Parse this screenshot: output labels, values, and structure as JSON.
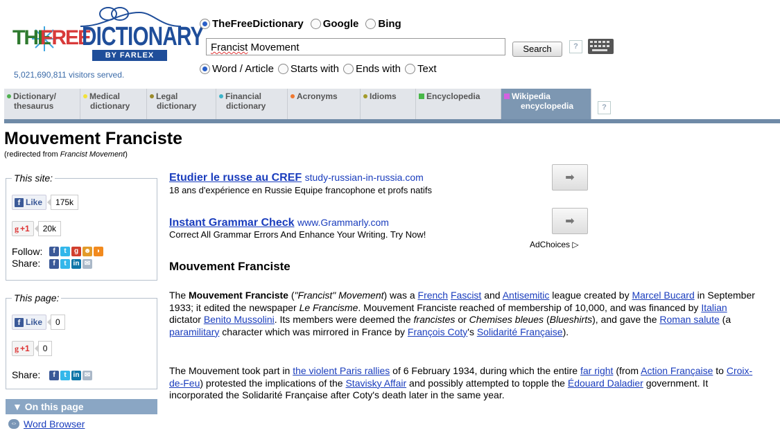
{
  "logo": {
    "the": "THE",
    "free": "FREE",
    "dictionary": "DICTIONARY",
    "by_farlex": "BY FARLEX",
    "visitors": "5,021,690,811 visitors served."
  },
  "search": {
    "engines": [
      "TheFreeDictionary",
      "Google",
      "Bing"
    ],
    "selected_engine": "TheFreeDictionary",
    "query_word1": "Francist",
    "query_word2": " Movement",
    "button": "Search",
    "help": "?",
    "modes": [
      "Word / Article",
      "Starts with",
      "Ends with",
      "Text"
    ],
    "selected_mode": "Word / Article"
  },
  "tabs": [
    {
      "line1": "Dictionary/",
      "line2": "thesaurus",
      "color": "#4fb04f",
      "shape": "dot"
    },
    {
      "line1": "Medical",
      "line2": "dictionary",
      "color": "#f2e23b",
      "shape": "dot"
    },
    {
      "line1": "Legal",
      "line2": "dictionary",
      "color": "#9a8a2a",
      "shape": "dot"
    },
    {
      "line1": "Financial",
      "line2": "dictionary",
      "color": "#3cb3c9",
      "shape": "dot"
    },
    {
      "line1": "Acronyms",
      "line2": "",
      "color": "#f07830",
      "shape": "dot"
    },
    {
      "line1": "Idioms",
      "line2": "",
      "color": "#a39a2a",
      "shape": "dot"
    },
    {
      "line1": "Encyclopedia",
      "line2": "",
      "color": "#48b848",
      "shape": "square"
    },
    {
      "line1": "Wikipedia",
      "line2": "encyclopedia",
      "color": "#d560e0",
      "shape": "square",
      "active": true
    }
  ],
  "tab_help": "?",
  "page": {
    "title": "Mouvement Franciste",
    "redirect_prefix": "(redirected from ",
    "redirect_term": "Francist Movement",
    "redirect_suffix": ")"
  },
  "this_site": {
    "legend": "This site:",
    "like_label": "Like",
    "like_count": "175k",
    "plus_label": "+1",
    "plus_count": "20k",
    "follow_label": "Follow:",
    "share_label": "Share:"
  },
  "this_page": {
    "legend": "This page:",
    "like_label": "Like",
    "like_count": "0",
    "plus_label": "+1",
    "plus_count": "0",
    "share_label": "Share:"
  },
  "on_this_page": {
    "header": "▼ On this page",
    "word_browser": "Word Browser"
  },
  "ads": [
    {
      "title": "Etudier le russe au CREF",
      "domain": "study-russian-in-russia.com",
      "desc": "18 ans d'expérience en Russie Equipe francophone et profs natifs"
    },
    {
      "title": "Instant Grammar Check",
      "domain": "www.Grammarly.com",
      "desc": "Correct All Grammar Errors And Enhance Your Writing. Try Now!"
    }
  ],
  "ad_arrow": "➡",
  "adchoices": "AdChoices ▷",
  "article": {
    "heading": "Mouvement Franciste",
    "p1": {
      "t1": "The ",
      "b1": "Mouvement Franciste",
      "t2": " (",
      "i1": "\"Francist\" Movement",
      "t3": ") was a ",
      "l1": "French",
      "t4": " ",
      "l2": "Fascist",
      "t5": " and ",
      "l3": "Antisemitic",
      "t6": " league created by ",
      "l4": "Marcel Bucard",
      "t7": " in September 1933; it edited the newspaper ",
      "i2": "Le Francisme",
      "t8": ". Mouvement Franciste reached of membership of 10,000, and was financed by ",
      "l5": "Italian",
      "t9": " dictator ",
      "l6": "Benito Mussolini",
      "t10": ". Its members were deemed the ",
      "i3": "francistes",
      "t11": " or ",
      "i4": "Chemises bleues",
      "t12": " (",
      "i5": "Blueshirts",
      "t13": "), and gave the ",
      "l7": "Roman salute",
      "t14": " (a ",
      "l8": "paramilitary",
      "t15": " character which was mirrored in France by ",
      "l9": "François Coty",
      "t16": "'s ",
      "l10": "Solidarité Française",
      "t17": ")."
    },
    "p2": {
      "t1": "The Mouvement took part in ",
      "l1": "the violent Paris rallies",
      "t2": " of 6 February 1934, during which the entire ",
      "l2": "far right",
      "t3": " (from ",
      "l3": "Action Française",
      "t4": " to ",
      "l4": "Croix-de-Feu",
      "t5": ") protested the implications of the ",
      "l5": "Stavisky Affair",
      "t6": " and possibly attempted to topple the ",
      "l6": "Édouard Daladier",
      "t7": " government. It incorporated the Solidarité Française after Coty's death later in the same year."
    }
  }
}
